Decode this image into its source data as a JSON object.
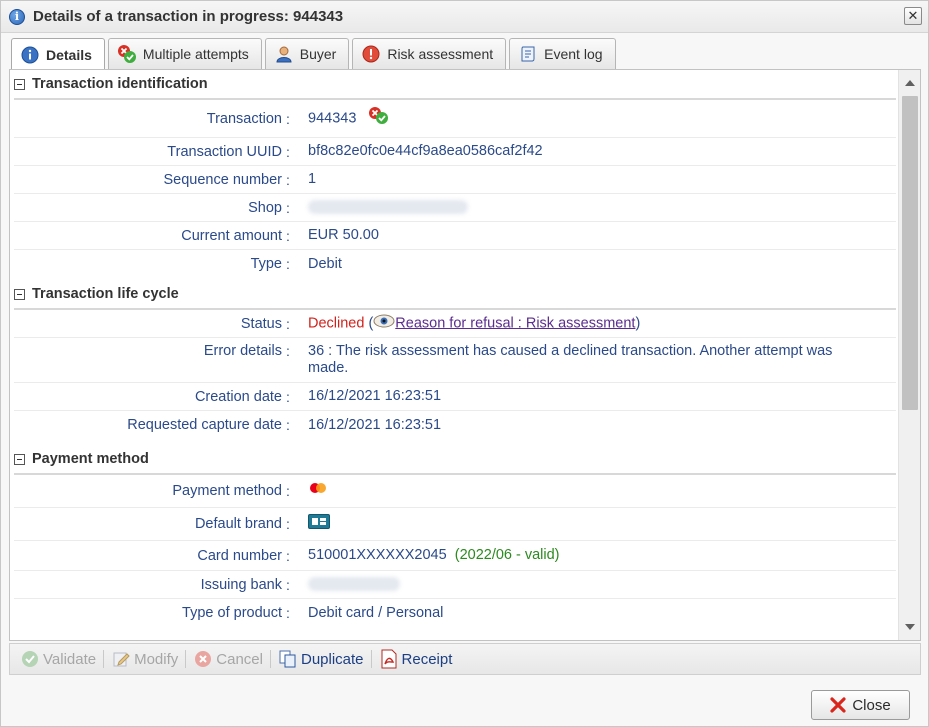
{
  "window": {
    "title": "Details of a transaction in progress: 944343"
  },
  "tabs": [
    {
      "label": "Details",
      "icon": "info-icon"
    },
    {
      "label": "Multiple attempts",
      "icon": "multiple-attempts-icon"
    },
    {
      "label": "Buyer",
      "icon": "buyer-icon"
    },
    {
      "label": "Risk assessment",
      "icon": "warning-icon"
    },
    {
      "label": "Event log",
      "icon": "event-log-icon"
    }
  ],
  "sections": {
    "identification": {
      "title": "Transaction identification",
      "transaction_label": "Transaction",
      "transaction_value": "944343",
      "uuid_label": "Transaction UUID",
      "uuid_value": "bf8c82e0fc0e44cf9a8ea0586caf2f42",
      "sequence_label": "Sequence number",
      "sequence_value": "1",
      "shop_label": "Shop",
      "amount_label": "Current amount",
      "amount_value": "EUR 50.00",
      "type_label": "Type",
      "type_value": "Debit"
    },
    "lifecycle": {
      "title": "Transaction life cycle",
      "status_label": "Status",
      "status_value": "Declined",
      "status_link": "Reason for refusal : Risk assessment",
      "error_label": "Error details",
      "error_value": "36 : The risk assessment has caused a declined transaction. Another attempt was made.",
      "creation_label": "Creation date",
      "creation_value": "16/12/2021 16:23:51",
      "capture_label": "Requested capture date",
      "capture_value": "16/12/2021 16:23:51"
    },
    "payment": {
      "title": "Payment method",
      "method_label": "Payment method",
      "brand_label": "Default brand",
      "card_label": "Card number",
      "card_value": "510001XXXXXX2045",
      "card_expiry": "(2022/06 - valid)",
      "bank_label": "Issuing bank",
      "product_label": "Type of product",
      "product_value": "Debit card / Personal"
    }
  },
  "actions": {
    "validate": "Validate",
    "modify": "Modify",
    "cancel": "Cancel",
    "duplicate": "Duplicate",
    "receipt": "Receipt"
  },
  "footer": {
    "close": "Close"
  },
  "colors": {
    "declined": "#d0221c",
    "valid": "#2b8a1e",
    "label": "#2b4a8a"
  }
}
